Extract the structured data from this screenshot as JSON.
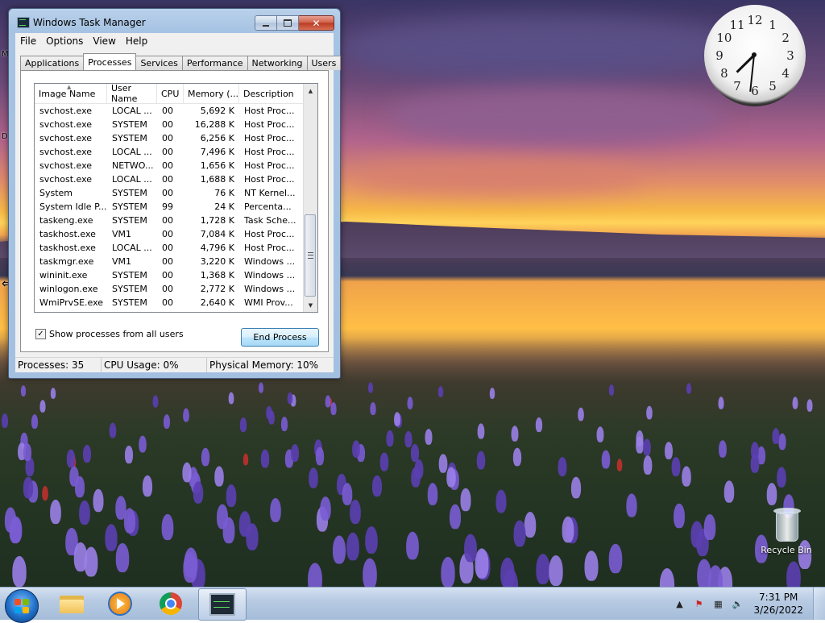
{
  "window": {
    "title": "Windows Task Manager",
    "menu": [
      "File",
      "Options",
      "View",
      "Help"
    ],
    "tabs": [
      "Applications",
      "Processes",
      "Services",
      "Performance",
      "Networking",
      "Users"
    ],
    "selected_tab": "Processes",
    "columns": [
      "Image Name",
      "User Name",
      "CPU",
      "Memory (...",
      "Description"
    ],
    "processes": [
      [
        "svchost.exe",
        "LOCAL ...",
        "00",
        "5,692 K",
        "Host Proc..."
      ],
      [
        "svchost.exe",
        "SYSTEM",
        "00",
        "16,288 K",
        "Host Proc..."
      ],
      [
        "svchost.exe",
        "SYSTEM",
        "00",
        "6,256 K",
        "Host Proc..."
      ],
      [
        "svchost.exe",
        "LOCAL ...",
        "00",
        "7,496 K",
        "Host Proc..."
      ],
      [
        "svchost.exe",
        "NETWO...",
        "00",
        "1,656 K",
        "Host Proc..."
      ],
      [
        "svchost.exe",
        "LOCAL ...",
        "00",
        "1,688 K",
        "Host Proc..."
      ],
      [
        "System",
        "SYSTEM",
        "00",
        "76 K",
        "NT Kernel..."
      ],
      [
        "System Idle P...",
        "SYSTEM",
        "99",
        "24 K",
        "Percenta..."
      ],
      [
        "taskeng.exe",
        "SYSTEM",
        "00",
        "1,728 K",
        "Task Sche..."
      ],
      [
        "taskhost.exe",
        "VM1",
        "00",
        "7,084 K",
        "Host Proc..."
      ],
      [
        "taskhost.exe",
        "LOCAL ...",
        "00",
        "4,796 K",
        "Host Proc..."
      ],
      [
        "taskmgr.exe",
        "VM1",
        "00",
        "3,220 K",
        "Windows ..."
      ],
      [
        "wininit.exe",
        "SYSTEM",
        "00",
        "1,368 K",
        "Windows ..."
      ],
      [
        "winlogon.exe",
        "SYSTEM",
        "00",
        "2,772 K",
        "Windows ..."
      ],
      [
        "WmiPrvSE.exe",
        "SYSTEM",
        "00",
        "2,640 K",
        "WMI Prov..."
      ]
    ],
    "show_all_label": "Show processes from all users",
    "show_all_checked": true,
    "end_process_label": "End Process",
    "status": {
      "processes": "Processes: 35",
      "cpu": "CPU Usage: 0%",
      "memory": "Physical Memory: 10%"
    }
  },
  "gadget_clock": {
    "numbers": [
      "12",
      "1",
      "2",
      "3",
      "4",
      "5",
      "6",
      "7",
      "8",
      "9",
      "10",
      "11"
    ],
    "hour": 7,
    "minute": 31
  },
  "desktop": {
    "recycle_bin_label": "Recycle Bin",
    "edge_letters": [
      "M",
      "D"
    ]
  },
  "taskbar": {
    "pinned": [
      "windows-explorer",
      "windows-media-player",
      "google-chrome",
      "task-manager"
    ],
    "active": "task-manager",
    "time": "7:31 PM",
    "date": "3/26/2022"
  },
  "colors": {
    "close_button": "#c8452c",
    "end_process_border": "#3c7fb1",
    "start_orb": "#1f6fc8"
  }
}
